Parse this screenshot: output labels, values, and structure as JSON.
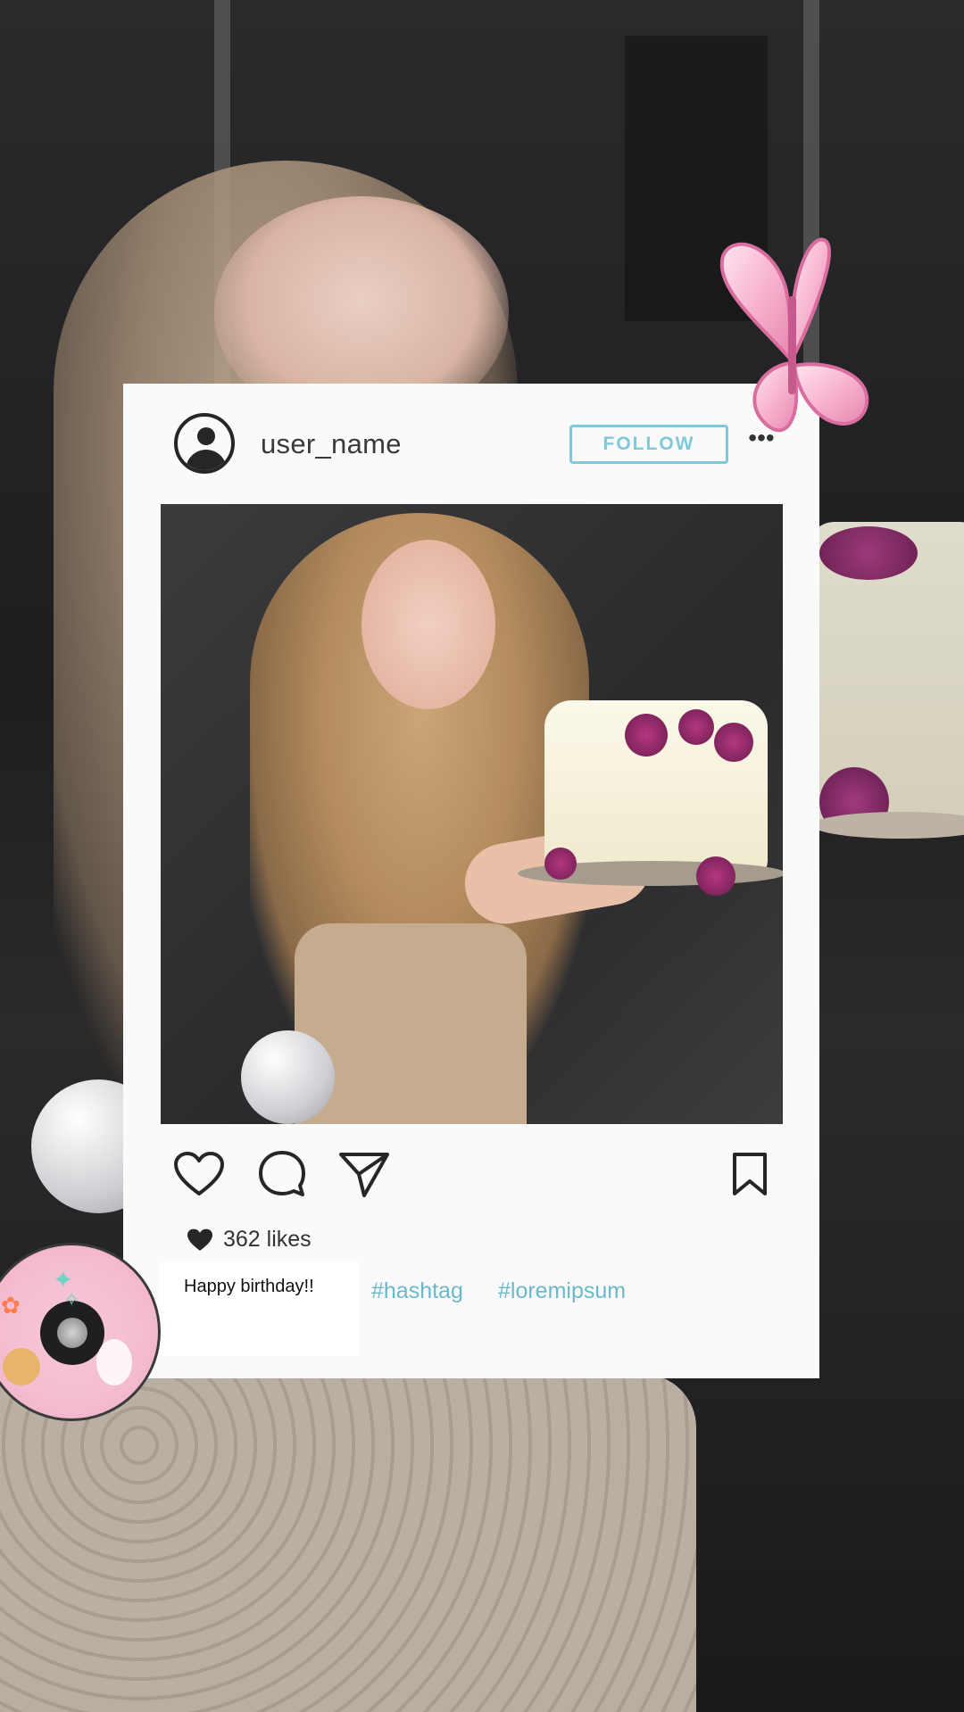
{
  "post": {
    "username": "user_name",
    "follow_label": "FOLLOW",
    "more_label": "•••",
    "likes_text": "362 likes",
    "caption": "Happy birthday!!",
    "hashtags": [
      "#hashtag",
      "#loremipsum"
    ]
  },
  "icons": {
    "avatar": "profile-avatar-icon",
    "more": "more-options-icon",
    "like": "heart-icon",
    "comment": "comment-bubble-icon",
    "share": "send-paper-plane-icon",
    "save": "bookmark-icon",
    "likes_heart": "filled-heart-icon"
  },
  "colors": {
    "follow_accent": "#7fc9dc",
    "hashtag": "#6bb8cc",
    "card_bg": "#fafafa"
  },
  "stickers": [
    "pink-butterfly-sticker",
    "pink-vinyl-disc-sticker"
  ]
}
